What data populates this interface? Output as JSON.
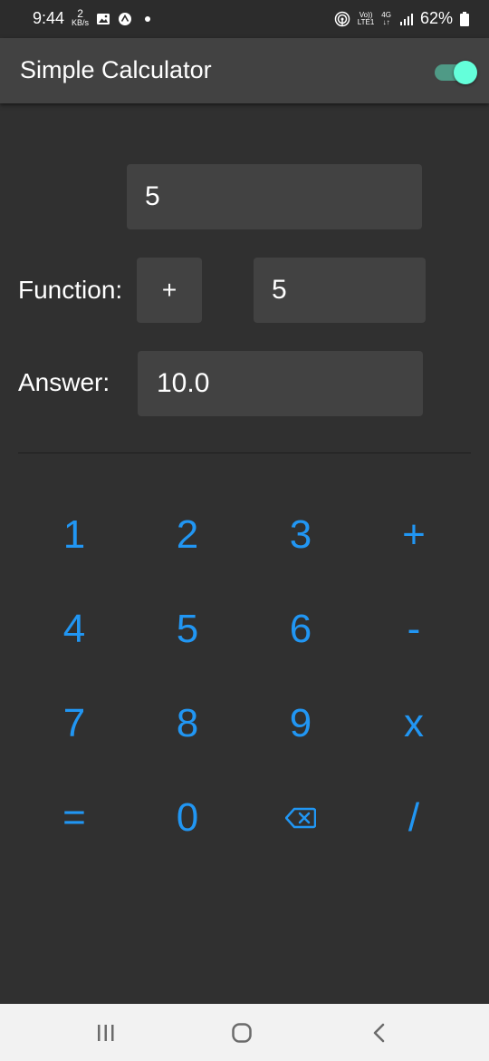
{
  "status": {
    "time": "9:44",
    "net_speed_value": "2",
    "net_speed_unit": "KB/s",
    "volte_top": "Vo))",
    "volte_bottom": "LTE1",
    "network": "4G",
    "battery": "62%"
  },
  "app": {
    "title": "Simple Calculator",
    "theme_toggle_on": true
  },
  "calculator": {
    "first_value": "5",
    "function_label": "Function:",
    "function_value": "+",
    "second_value": "5",
    "answer_label": "Answer:",
    "answer_value": "10.0"
  },
  "keypad": {
    "k1": "1",
    "k2": "2",
    "k3": "3",
    "plus": "+",
    "k4": "4",
    "k5": "5",
    "k6": "6",
    "minus": "-",
    "k7": "7",
    "k8": "8",
    "k9": "9",
    "times": "x",
    "equals": "=",
    "k0": "0",
    "backspace_icon": "backspace-icon",
    "divide": "/"
  },
  "colors": {
    "accent": "#2196f3",
    "toggle_thumb": "#64ffda",
    "appbar": "#424242",
    "background": "#303030"
  }
}
